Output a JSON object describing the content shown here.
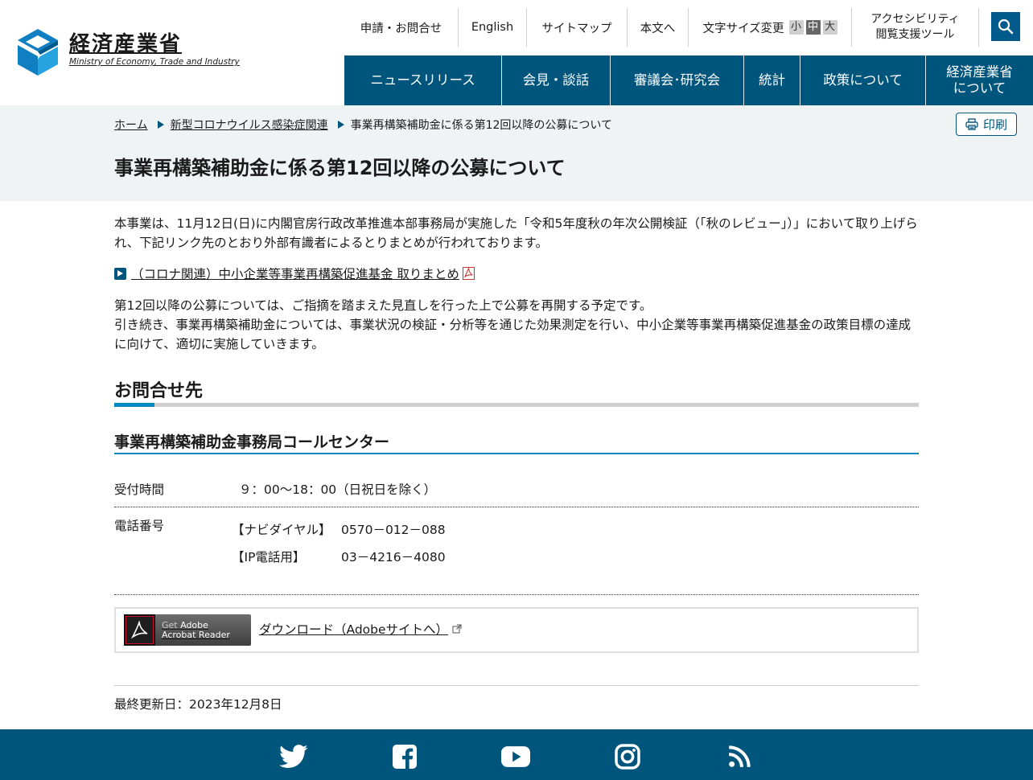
{
  "logo": {
    "jp": "経済産業省",
    "en": "Ministry of Economy, Trade and Industry"
  },
  "util": {
    "contact": "申請・お問合せ",
    "english": "English",
    "sitemap": "サイトマップ",
    "skip": "本文へ",
    "font_size_label": "文字サイズ変更",
    "font_small": "小",
    "font_medium": "中",
    "font_large": "大",
    "accessibility_line1": "アクセシビリティ",
    "accessibility_line2": "閲覧支援ツール"
  },
  "gnav": {
    "news": "ニュースリリース",
    "press": "会見・談話",
    "council": "審議会･研究会",
    "stats": "統計",
    "policy": "政策について",
    "about_line1": "経済産業省",
    "about_line2": "について"
  },
  "breadcrumb": {
    "home": "ホーム",
    "covid": "新型コロナウイルス感染症関連",
    "current": "事業再構築補助金に係る第12回以降の公募について"
  },
  "print_label": "印刷",
  "page_title": "事業再構築補助金に係る第12回以降の公募について",
  "body": {
    "para1": "本事業は、11月12日(日)に内閣官房行政改革推進本部事務局が実施した「令和5年度秋の年次公開検証（「秋のレビュー」）」において取り上げられ、下記リンク先のとおり外部有識者によるとりまとめが行われております。",
    "pdf_link": "（コロナ関連）中小企業等事業再構築促進基金 取りまとめ",
    "para2_line1": "第12回以降の公募については、ご指摘を踏まえた見直しを行った上で公募を再開する予定です。",
    "para2_line2": "引き続き、事業再構築補助金については、事業状況の検証・分析等を通じた効果測定を行い、中小企業等事業再構築促進基金の政策目標の達成に向けて、適切に実施していきます。"
  },
  "contact": {
    "heading": "お問合せ先",
    "subheading": "事業再構築補助金事務局コールセンター",
    "hours_label": "受付時間",
    "hours_value": "９：00～18：00（日祝日を除く）",
    "phone_label": "電話番号",
    "navi_label": "【ナビダイヤル】",
    "navi_number": "0570－012－088",
    "ip_label": "【IP電話用】",
    "ip_number": "03－4216－4080"
  },
  "adobe": {
    "badge_get": "Get",
    "badge_adobe": "Adobe",
    "badge_reader": "Acrobat Reader",
    "download_link": "ダウンロード（Adobeサイトへ）"
  },
  "last_updated": "最終更新日：2023年12月8日",
  "colors": {
    "brand": "#00557d",
    "accent": "#0088c4",
    "band": "#eff3f3"
  },
  "footer_icons": [
    "twitter-icon",
    "facebook-icon",
    "youtube-icon",
    "instagram-icon",
    "rss-icon"
  ]
}
